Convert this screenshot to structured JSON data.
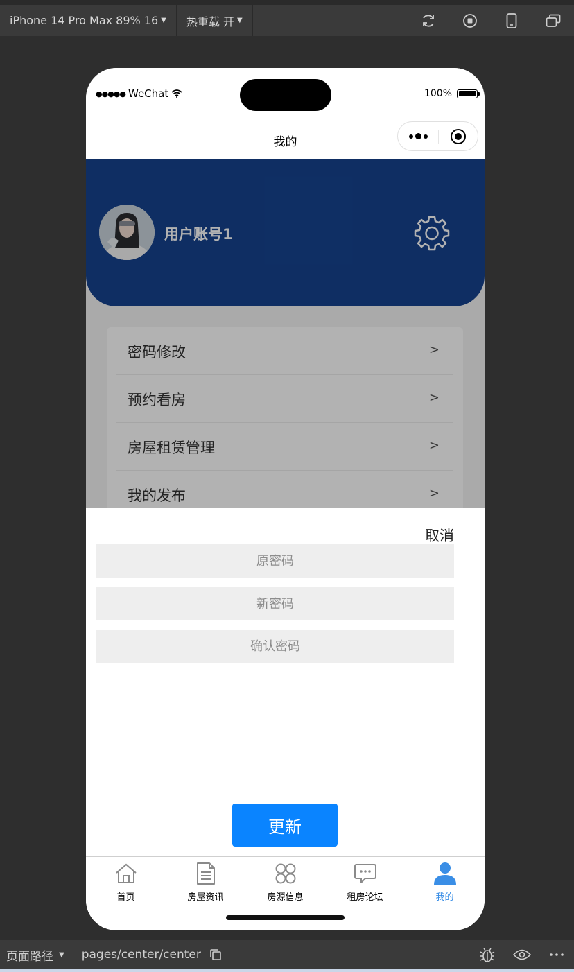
{
  "toolbar": {
    "device": "iPhone 14 Pro Max 89% 16",
    "hot_reload": "热重载 开"
  },
  "status_bar": {
    "carrier": "WeChat",
    "battery": "100%"
  },
  "nav": {
    "title": "我的"
  },
  "profile": {
    "username": "用户账号1"
  },
  "menu": {
    "items": [
      {
        "label": "密码修改",
        "arrow": ">"
      },
      {
        "label": "预约看房",
        "arrow": ">"
      },
      {
        "label": "房屋租赁管理",
        "arrow": ">"
      },
      {
        "label": "我的发布",
        "arrow": ">"
      }
    ]
  },
  "sheet": {
    "cancel": "取消",
    "old_placeholder": "原密码",
    "new_placeholder": "新密码",
    "confirm_placeholder": "确认密码",
    "update": "更新"
  },
  "tabs": [
    {
      "label": "首页",
      "icon": "home-icon"
    },
    {
      "label": "房屋资讯",
      "icon": "document-icon"
    },
    {
      "label": "房源信息",
      "icon": "grid-icon"
    },
    {
      "label": "租房论坛",
      "icon": "chat-icon"
    },
    {
      "label": "我的",
      "icon": "user-icon",
      "active": true
    }
  ],
  "bottom_bar": {
    "path_label": "页面路径",
    "path": "pages/center/center"
  },
  "colors": {
    "header_blue": "#16438f",
    "button_blue": "#0a84ff",
    "active_tab": "#3a8ee6"
  }
}
